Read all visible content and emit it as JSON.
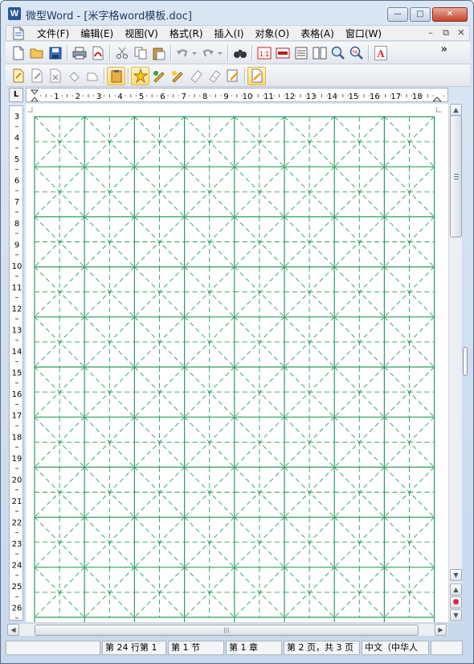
{
  "window": {
    "title": "微型Word - [米字格word模板.doc]",
    "app_icon_letter": "W",
    "minimize": "—",
    "maximize": "□",
    "close": "✕"
  },
  "menu": {
    "items": [
      "文件(F)",
      "编辑(E)",
      "视图(V)",
      "格式(R)",
      "插入(I)",
      "对象(O)",
      "表格(A)",
      "窗口(W)"
    ],
    "mdi_minimize": "–",
    "mdi_restore": "⧉",
    "mdi_close": "✕"
  },
  "toolbar1": {
    "buttons": [
      "new-doc",
      "open-folder",
      "save",
      "print",
      "pdf",
      "cut",
      "copy",
      "paste",
      "undo",
      "redo",
      "find",
      "zoom-100",
      "insert-table",
      "columns",
      "page-view",
      "magnifier",
      "percent",
      "font-color"
    ],
    "more": "»"
  },
  "toolbar2": {
    "buttons": [
      "edit-insert",
      "edit-pen",
      "delete-mark",
      "rotate-left",
      "rotate-right",
      "clipboard",
      "star-edit",
      "highlight-green",
      "highlight-yellow",
      "eraser-one",
      "eraser-two",
      "note"
    ]
  },
  "ruler": {
    "corner": "L",
    "h_numbers": [
      "1",
      "2",
      "3",
      "4",
      "5",
      "6",
      "7",
      "8",
      "9",
      "10",
      "11",
      "12",
      "13",
      "14",
      "15",
      "16",
      "17",
      "18"
    ],
    "v_numbers": [
      "3",
      "4",
      "5",
      "6",
      "7",
      "8",
      "9",
      "10",
      "11",
      "12",
      "13",
      "14",
      "15",
      "16",
      "17",
      "18",
      "19",
      "20",
      "21",
      "22",
      "23",
      "24",
      "25",
      "26"
    ]
  },
  "grid": {
    "columns": 8,
    "rows": 10,
    "line_color": "#2e9b62"
  },
  "status": {
    "blank": "",
    "row": "第 24 行第 1",
    "section": "第 1 节",
    "chapter": "第 1 章",
    "page": "第 2 页，共 3 页",
    "lang": "中文（中华人",
    "last": ""
  }
}
